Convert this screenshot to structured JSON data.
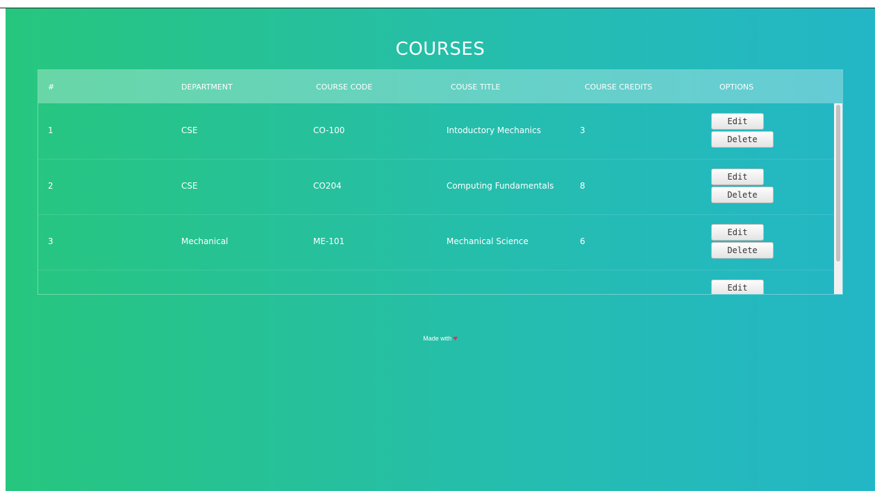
{
  "page_title": "COURSES",
  "table": {
    "headers": [
      "#",
      "DEPARTMENT",
      "COURSE CODE",
      "COUSE TITLE",
      "COURSE CREDITS",
      "OPTIONS"
    ],
    "rows": [
      {
        "num": "1",
        "department": "CSE",
        "code": "CO-100",
        "title": "Intoductory Mechanics",
        "credits": "3"
      },
      {
        "num": "2",
        "department": "CSE",
        "code": "CO204",
        "title": "Computing Fundamentals",
        "credits": "8"
      },
      {
        "num": "3",
        "department": "Mechanical",
        "code": "ME-101",
        "title": "Mechanical Science",
        "credits": "6"
      },
      {
        "num": "",
        "department": "",
        "code": "",
        "title": "",
        "credits": ""
      }
    ],
    "edit_label": "Edit",
    "delete_label": "Delete"
  },
  "footer": {
    "text": "Made with",
    "heart": "♥"
  },
  "colors": {
    "gradient_start": "#27c67e",
    "gradient_end": "#23b6c6",
    "heart": "#e0245e"
  }
}
